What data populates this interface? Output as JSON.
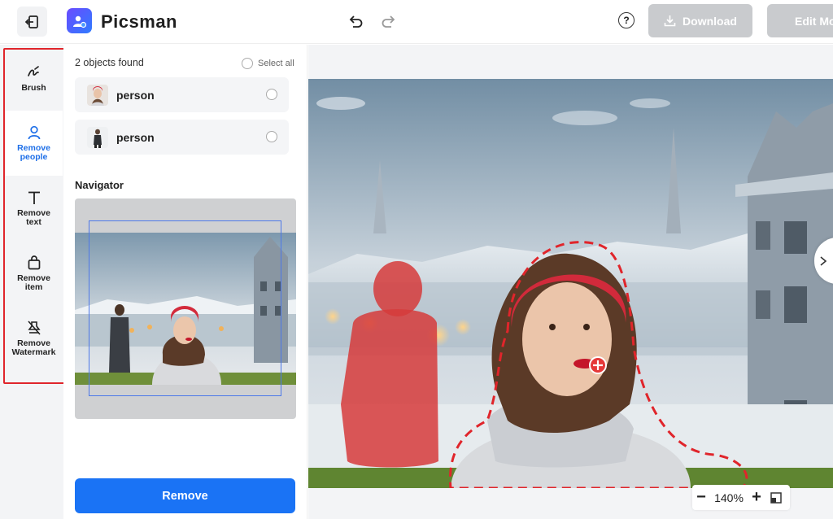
{
  "app": {
    "name": "Picsman"
  },
  "header": {
    "download_label": "Download",
    "edit_label": "Edit Mo",
    "help_label": "?"
  },
  "tools": [
    {
      "label_line1": "Brush",
      "label_line2": "",
      "icon": "brush-icon",
      "active": false
    },
    {
      "label_line1": "Remove",
      "label_line2": "people",
      "icon": "person-icon",
      "active": true
    },
    {
      "label_line1": "Remove",
      "label_line2": "text",
      "icon": "text-icon",
      "active": false
    },
    {
      "label_line1": "Remove",
      "label_line2": "item",
      "icon": "bag-icon",
      "active": false
    },
    {
      "label_line1": "Remove",
      "label_line2": "Watermark",
      "icon": "watermark-icon",
      "active": false
    }
  ],
  "panel": {
    "found_text": "2 objects found",
    "select_all_label": "Select all",
    "objects": [
      {
        "label": "person"
      },
      {
        "label": "person"
      }
    ],
    "navigator_title": "Navigator",
    "remove_label": "Remove"
  },
  "zoom": {
    "value": "140%",
    "minus": "−",
    "plus": "+"
  },
  "colors": {
    "accent": "#1a73f5",
    "highlight_border": "#e0252b",
    "disabled_button": "#c9cbce",
    "selection_mask": "#d63b3b"
  }
}
